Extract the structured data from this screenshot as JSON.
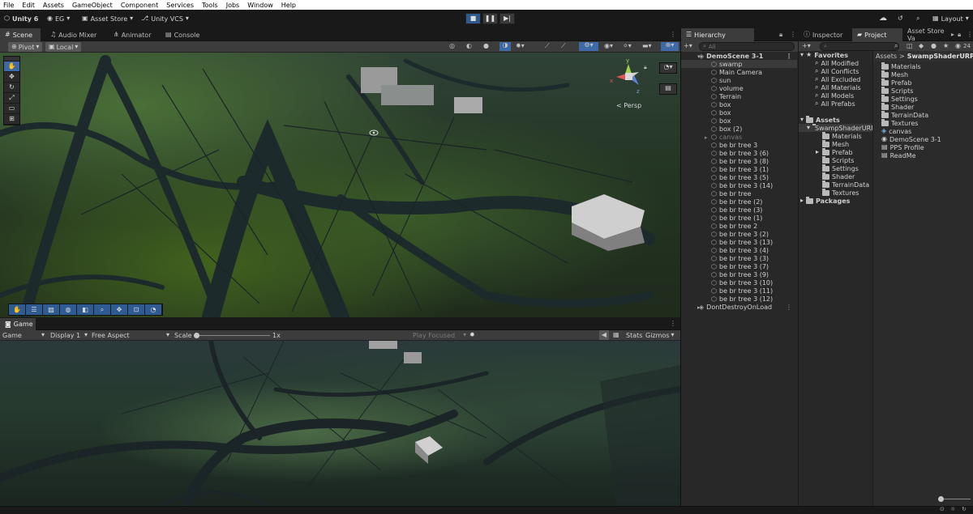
{
  "menu": [
    "File",
    "Edit",
    "Assets",
    "GameObject",
    "Component",
    "Services",
    "Tools",
    "Jobs",
    "Window",
    "Help"
  ],
  "toolbar": {
    "unity_label": "Unity 6",
    "account_label": "EG",
    "asset_store_label": "Asset Store",
    "vcs_label": "Unity VCS",
    "layout_label": "Layout"
  },
  "scene_tabs": [
    "Scene",
    "Audio Mixer",
    "Animator",
    "Console"
  ],
  "scene_toolbar": {
    "pivot": "Pivot",
    "local": "Local"
  },
  "scene_view": {
    "persp_label": "< Persp",
    "axis_y": "y",
    "axis_x": "x",
    "axis_z": "z"
  },
  "game_tab": "Game",
  "game_toolbar": {
    "game_dropdown": "Game",
    "display": "Display 1",
    "aspect": "Free Aspect",
    "scale_label": "Scale",
    "scale_value": "1x",
    "play_focused": "Play Focused",
    "stats": "Stats",
    "gizmos": "Gizmos"
  },
  "hierarchy": {
    "tab": "Hierarchy",
    "search_placeholder": "All",
    "scene": "DemoScene 3-1",
    "items": [
      "swamp",
      "Main Camera",
      "sun",
      "volume",
      "Terrain",
      "box",
      "box",
      "box",
      "box (2)",
      "canvas",
      "be br tree 3",
      "be br tree 3 (6)",
      "be br tree 3 (8)",
      "be br tree 3 (1)",
      "be br tree 3 (5)",
      "be br tree 3 (14)",
      "be br tree",
      "be br tree (2)",
      "be br tree (3)",
      "be br tree (1)",
      "be br tree 2",
      "be br tree 3 (2)",
      "be br tree 3 (13)",
      "be br tree 3 (4)",
      "be br tree 3 (3)",
      "be br tree 3 (7)",
      "be br tree 3 (9)",
      "be br tree 3 (10)",
      "be br tree 3 (11)",
      "be br tree 3 (12)"
    ],
    "dont_destroy": "DontDestroyOnLoad"
  },
  "right_tabs": {
    "inspector": "Inspector",
    "project": "Project",
    "asset_store": "Asset Store Va"
  },
  "project": {
    "badge": "24",
    "favorites_label": "Favorites",
    "favorites": [
      "All Modified",
      "All Conflicts",
      "All Excluded",
      "All Materials",
      "All Models",
      "All Prefabs"
    ],
    "assets_label": "Assets",
    "swamp_folder": "SwampShaderURP",
    "swamp_children": [
      "Materials",
      "Mesh",
      "Prefab",
      "Scripts",
      "Settings",
      "Shader",
      "TerrainData",
      "Textures"
    ],
    "packages_label": "Packages",
    "breadcrumb_root": "Assets",
    "breadcrumb_sep": ">",
    "breadcrumb_current": "SwampShaderURP",
    "contents": [
      {
        "name": "Materials",
        "icon": "folder-icon"
      },
      {
        "name": "Mesh",
        "icon": "folder-icon"
      },
      {
        "name": "Prefab",
        "icon": "folder-icon"
      },
      {
        "name": "Scripts",
        "icon": "folder-icon"
      },
      {
        "name": "Settings",
        "icon": "folder-icon"
      },
      {
        "name": "Shader",
        "icon": "folder-icon"
      },
      {
        "name": "TerrainData",
        "icon": "folder-icon"
      },
      {
        "name": "Textures",
        "icon": "folder-icon"
      },
      {
        "name": "canvas",
        "icon": "prefab-icon"
      },
      {
        "name": "DemoScene 3-1",
        "icon": "scene-icon"
      },
      {
        "name": "PPS Profile",
        "icon": "asset-icon"
      },
      {
        "name": "ReadMe",
        "icon": "asset-icon"
      }
    ]
  },
  "colors": {
    "accent": "#3d6aa6",
    "panel": "#282828",
    "bar": "#3c3c3c"
  }
}
